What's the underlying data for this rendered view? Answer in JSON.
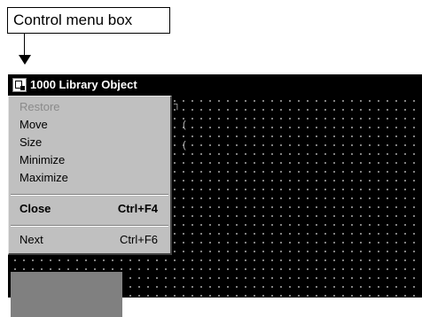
{
  "callout": {
    "label": "Control menu box"
  },
  "window": {
    "title": "1000 Library Object",
    "fragments": [
      "┐",
      "(",
      "("
    ]
  },
  "control_menu": {
    "items": [
      {
        "label": "Restore",
        "enabled": false
      },
      {
        "label": "Move",
        "enabled": true
      },
      {
        "label": "Size",
        "enabled": true
      },
      {
        "label": "Minimize",
        "enabled": true
      },
      {
        "label": "Maximize",
        "enabled": true
      },
      {
        "label": "Close",
        "shortcut": "Ctrl+F4",
        "enabled": true,
        "bold": true
      },
      {
        "label": "Next",
        "shortcut": "Ctrl+F6",
        "enabled": true
      }
    ]
  },
  "colors": {
    "menu_bg": "#c0c0c0",
    "disabled_text": "#8a8a8a",
    "window_bg": "#000000",
    "title_text": "#ffffff"
  }
}
